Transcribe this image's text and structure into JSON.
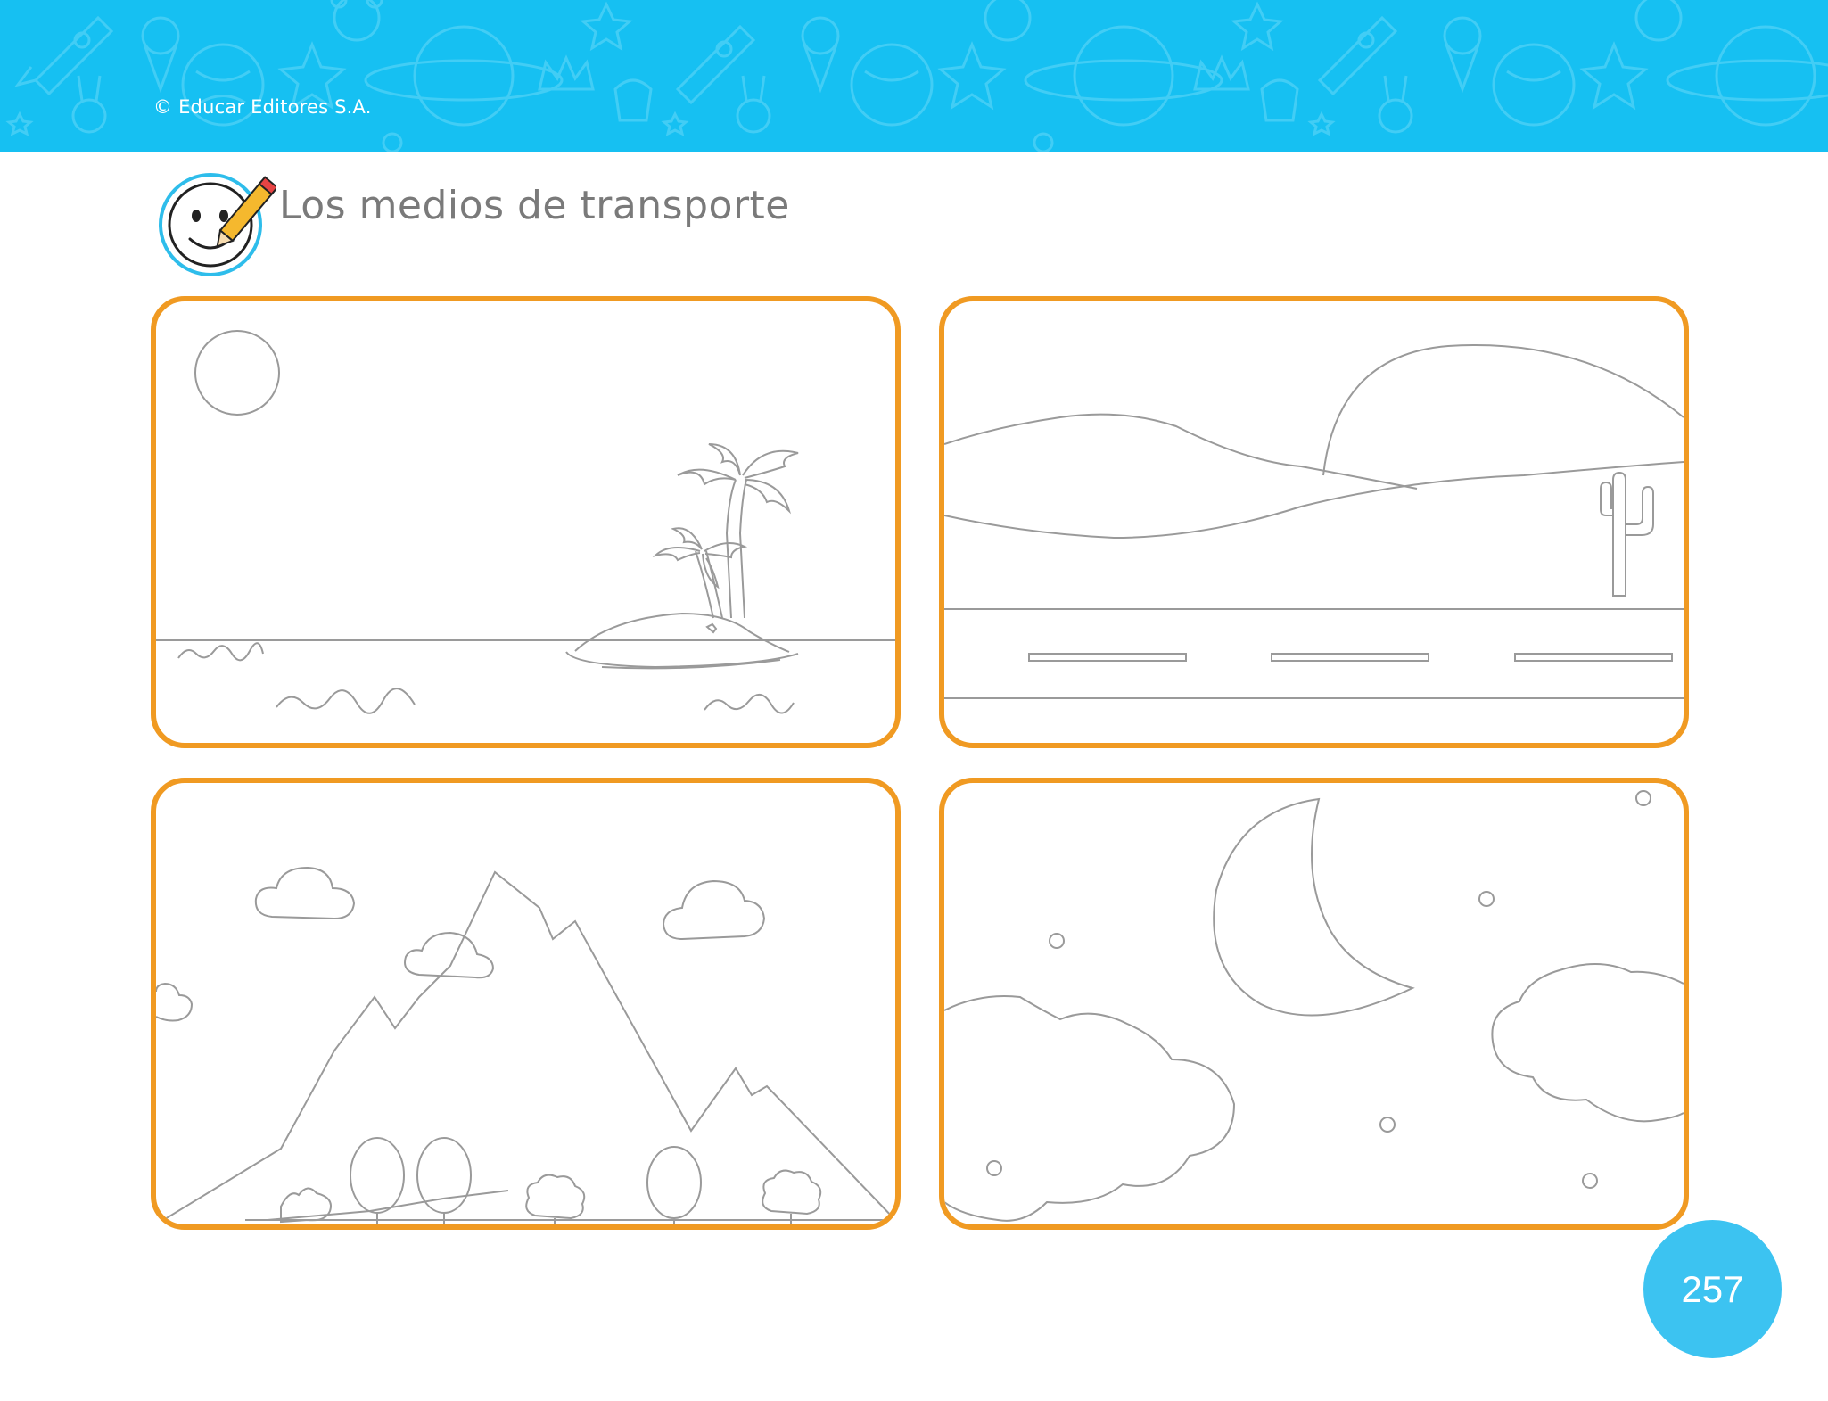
{
  "header": {
    "copyright": "© Educar Editores S.A.",
    "background_color": "#16c0f2"
  },
  "title": {
    "text": "Los medios de transporte",
    "icon": "smiley-pencil-icon"
  },
  "panels": [
    {
      "scene": "sea-island",
      "icon": "palm-island-scene"
    },
    {
      "scene": "desert-road",
      "icon": "desert-road-scene"
    },
    {
      "scene": "mountain",
      "icon": "mountain-scene"
    },
    {
      "scene": "night-sky",
      "icon": "moon-night-scene"
    }
  ],
  "colors": {
    "panel_border": "#f09a22",
    "line_art": "#9a9a9a",
    "badge": "#3cc3f1"
  },
  "footer": {
    "page_number": "257"
  }
}
